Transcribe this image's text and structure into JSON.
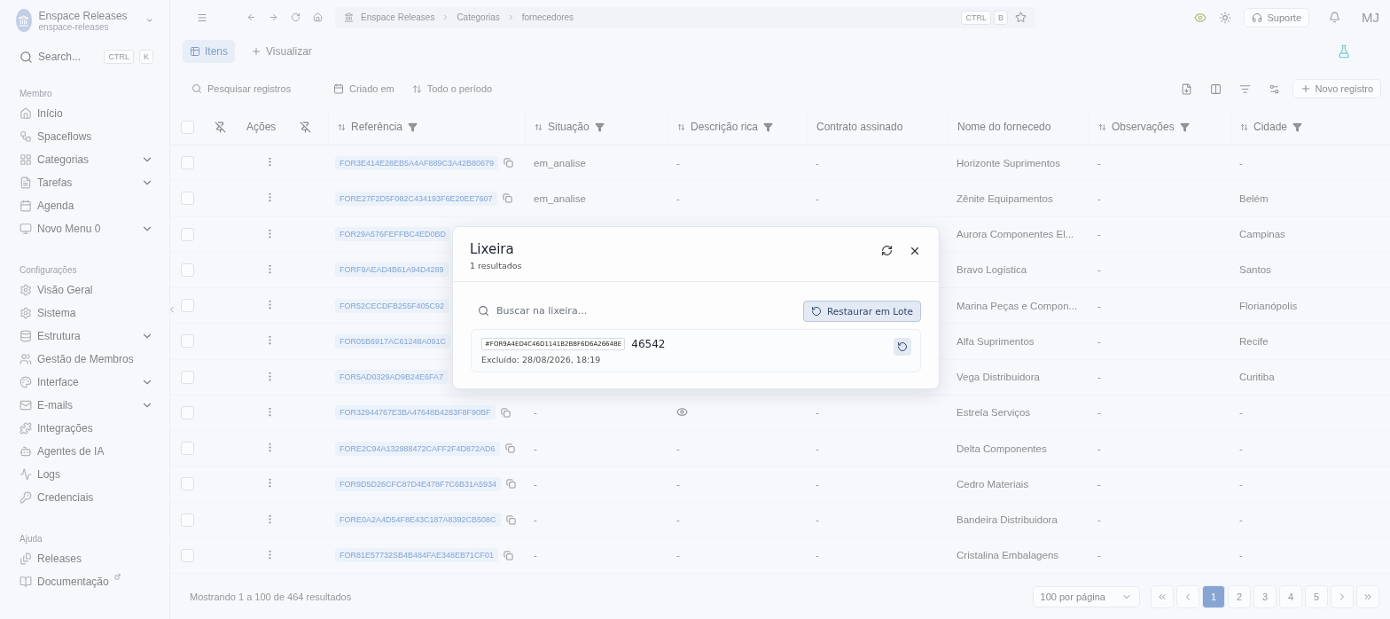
{
  "workspace": {
    "name": "Enspace Releases",
    "slug": "enspace-releases"
  },
  "sidebar": {
    "search": {
      "placeholder": "Search...",
      "keys": [
        "CTRL",
        "K"
      ]
    },
    "sections": [
      {
        "title": "Membro",
        "items": [
          {
            "label": "Início",
            "expandable": false
          },
          {
            "label": "Spaceflows",
            "expandable": false
          },
          {
            "label": "Categorias",
            "expandable": true
          },
          {
            "label": "Tarefas",
            "expandable": true
          },
          {
            "label": "Agenda",
            "expandable": false
          },
          {
            "label": "Novo Menu 0",
            "expandable": true
          }
        ]
      },
      {
        "title": "Configurações",
        "items": [
          {
            "label": "Visão Geral",
            "expandable": false
          },
          {
            "label": "Sistema",
            "expandable": false
          },
          {
            "label": "Estrutura",
            "expandable": true
          },
          {
            "label": "Gestão de Membros",
            "expandable": false
          },
          {
            "label": "Interface",
            "expandable": true
          },
          {
            "label": "E-mails",
            "expandable": true
          },
          {
            "label": "Integrações",
            "expandable": false
          },
          {
            "label": "Agentes de IA",
            "expandable": false
          },
          {
            "label": "Logs",
            "expandable": false
          },
          {
            "label": "Credenciais",
            "expandable": false
          }
        ]
      },
      {
        "title": "Ajuda",
        "items": [
          {
            "label": "Releases",
            "expandable": false
          },
          {
            "label": "Documentação",
            "expandable": false,
            "external": true
          }
        ]
      }
    ]
  },
  "topbar": {
    "breadcrumb": [
      "Enspace Releases",
      "Categorias",
      "fornecedores"
    ],
    "shortcut": [
      "CTRL",
      "B"
    ],
    "support": "Suporte",
    "avatar": "MJ"
  },
  "tabs": [
    {
      "label": "Itens",
      "selected": true
    },
    {
      "label": "Visualizar",
      "selected": false
    }
  ],
  "toolbar": {
    "search_placeholder": "Pesquisar registros",
    "date_field": "Criado em",
    "period": "Todo o período",
    "new_button": "Novo registro"
  },
  "table": {
    "all_checked": false,
    "columns": [
      {
        "label": "Ações",
        "sortable": false,
        "filter": false
      },
      {
        "label": "Referência",
        "sortable": true,
        "filter": true
      },
      {
        "label": "Situação",
        "sortable": true,
        "filter": true
      },
      {
        "label": "Descrição rica",
        "sortable": true,
        "filter": true
      },
      {
        "label": "Contrato assinado",
        "sortable": false,
        "filter": false
      },
      {
        "label": "Nome do fornecedo",
        "sortable": false,
        "filter": false
      },
      {
        "label": "Observações",
        "sortable": true,
        "filter": true
      },
      {
        "label": "Cidade",
        "sortable": true,
        "filter": true
      }
    ],
    "rows": [
      {
        "checked": false,
        "reference": "FOR3E414E28EB5A4AF889C3A42B80679",
        "status": "em_analise",
        "description": "-",
        "contract": "-",
        "supplier": "Horizonte Suprimentos",
        "notes": "-",
        "city": "-"
      },
      {
        "checked": false,
        "reference": "FORE27F2D5F082C434193F6E20EE7607",
        "status": "em_analise",
        "description": "-",
        "contract": "-",
        "supplier": "Zênite Equipamentos",
        "notes": "-",
        "city": "Belém"
      },
      {
        "checked": false,
        "reference": "FOR29A576FEFFBC4ED0BD",
        "supplier": "Aurora Componentes El...",
        "notes": "-",
        "city": "Campinas"
      },
      {
        "checked": false,
        "reference": "FORF9AEAD4B61A94D4289",
        "supplier": "Bravo Logística",
        "notes": "-",
        "city": "Santos"
      },
      {
        "checked": false,
        "reference": "FOR52CECDFB255F405C92",
        "supplier": "Marina Peças e Compon...",
        "notes": "-",
        "city": "Florianópolis"
      },
      {
        "checked": false,
        "reference": "FOR05B6917AC61248A091C",
        "supplier": "Alfa Suprimentos",
        "notes": "-",
        "city": "Recife"
      },
      {
        "checked": false,
        "reference": "FOR5AD0329AD9B24E6FA7",
        "supplier": "Vega Distribuidora",
        "notes": "-",
        "city": "Curitiba"
      },
      {
        "checked": false,
        "reference": "FOR32944767E3BA47648B4283F8F90BF",
        "status": "-",
        "preview": true,
        "contract": "-",
        "supplier": "Estrela Serviços",
        "notes": "-",
        "city": "-"
      },
      {
        "checked": false,
        "reference": "FORE2C94A132988472CAFF2F4D872AD6",
        "status": "-",
        "description": "-",
        "contract": "-",
        "supplier": "Delta Componentes",
        "notes": "-",
        "city": "-"
      },
      {
        "checked": false,
        "reference": "FOR9D5D26CFC87D4E478F7C6B31A5934",
        "status": "-",
        "description": "-",
        "contract": "-",
        "supplier": "Cedro Materiais",
        "notes": "-",
        "city": "-"
      },
      {
        "checked": false,
        "reference": "FORE0A2A4D54F8E43C187A8392CB508C",
        "status": "-",
        "description": "-",
        "contract": "-",
        "supplier": "Bandeira Distribuidora",
        "notes": "-",
        "city": "-"
      },
      {
        "checked": false,
        "reference": "FOR81E57732SB4B484FAE348EB71CF01",
        "status": "-",
        "description": "-",
        "contract": "-",
        "supplier": "Cristalina Embalagens",
        "notes": "-",
        "city": "-"
      }
    ]
  },
  "footer": {
    "summary": "Mostrando 1 a 100 de 464 resultados",
    "per_page": "100 por página",
    "pages": [
      {
        "label": "1",
        "selected": true
      },
      {
        "label": "2",
        "selected": false
      },
      {
        "label": "3",
        "selected": false
      },
      {
        "label": "4",
        "selected": false
      },
      {
        "label": "5",
        "selected": false
      }
    ]
  },
  "dialog": {
    "title": "Lixeira",
    "subtitle": "1 resultados",
    "search_placeholder": "Buscar na lixeira...",
    "restore_all": "Restaurar em Lote",
    "items": [
      {
        "id": "#FOR9A4ED4C46D1141B2BBF6D6A2664BE",
        "value": "46542",
        "deleted": "Excluído: 28/08/2026, 18:19"
      }
    ]
  }
}
